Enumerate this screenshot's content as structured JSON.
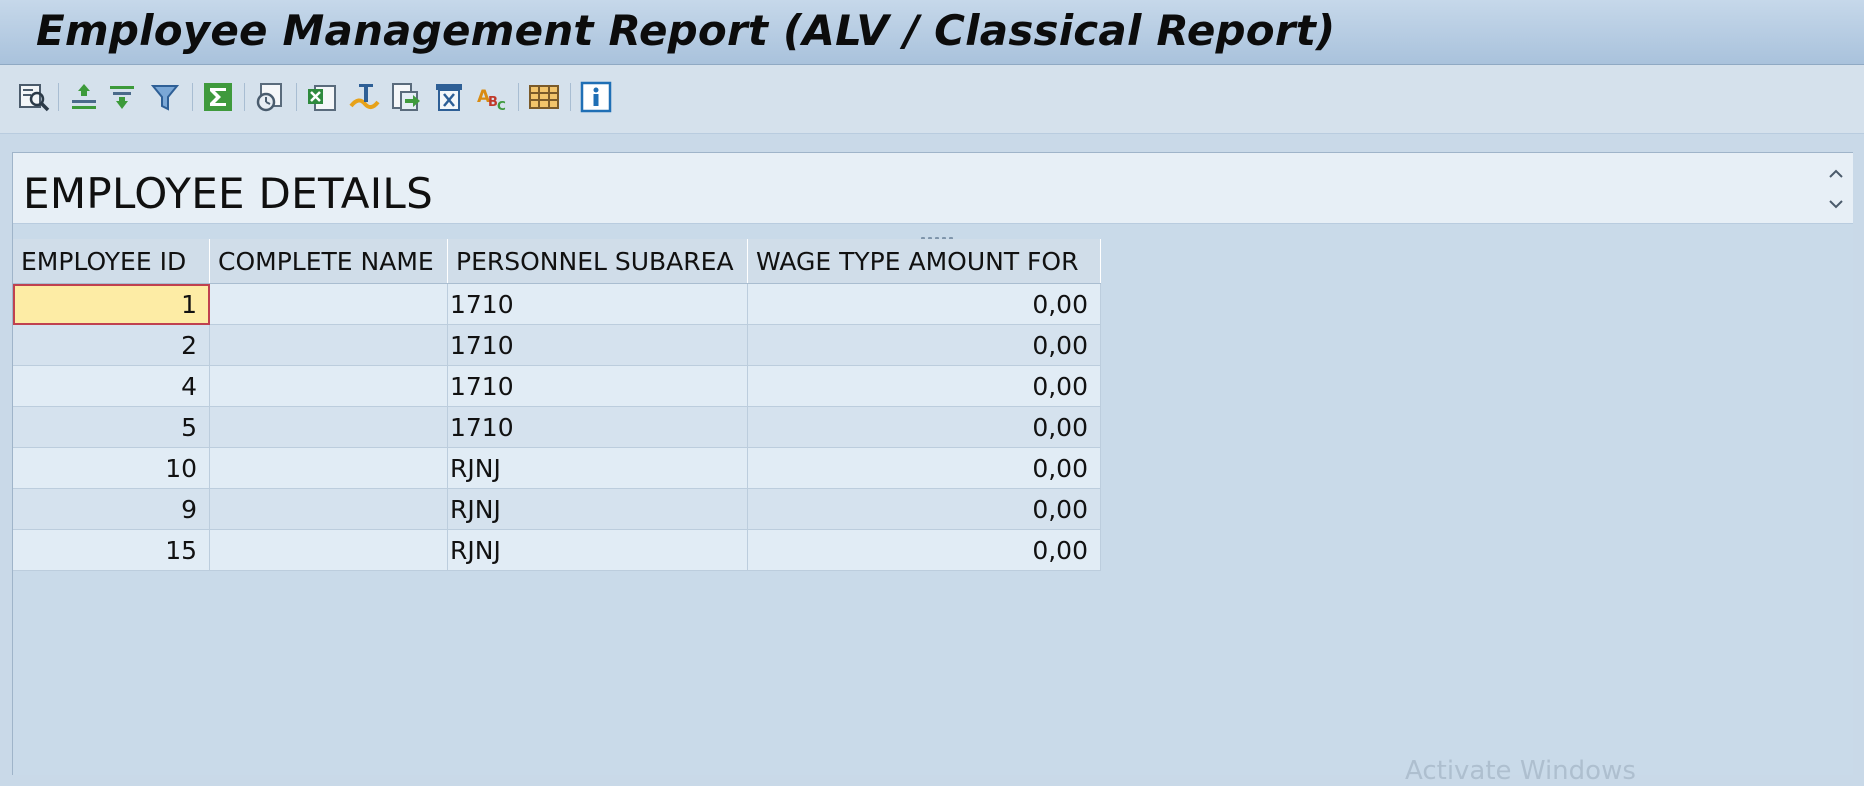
{
  "window": {
    "title": "Employee Management Report (ALV / Classical Report)"
  },
  "toolbar": {
    "buttons": [
      {
        "icon": "details-icon",
        "label": "Details"
      },
      {
        "icon": "sort-ascending-icon",
        "label": "Sort in Ascending Order"
      },
      {
        "icon": "sort-descending-icon",
        "label": "Sort in Descending Order"
      },
      {
        "icon": "filter-icon",
        "label": "Set Filter"
      },
      {
        "icon": "total-icon",
        "label": "Total"
      },
      {
        "icon": "print-preview-icon",
        "label": "Print Preview"
      },
      {
        "icon": "spreadsheet-icon",
        "label": "Spreadsheet"
      },
      {
        "icon": "word-processing-icon",
        "label": "Word Processing"
      },
      {
        "icon": "local-file-icon",
        "label": "Local File"
      },
      {
        "icon": "send-icon",
        "label": "Send"
      },
      {
        "icon": "abc-analysis-icon",
        "label": "ABC Analysis"
      },
      {
        "icon": "layout-icon",
        "label": "Change Layout"
      },
      {
        "icon": "info-icon",
        "label": "Information"
      }
    ]
  },
  "header": {
    "text": "EMPLOYEE DETAILS"
  },
  "table": {
    "columns": [
      "EMPLOYEE ID",
      "COMPLETE NAME",
      "PERSONNEL SUBAREA",
      "WAGE TYPE AMOUNT FOR"
    ],
    "rows": [
      [
        "1",
        "",
        "1710",
        "0,00"
      ],
      [
        "2",
        "",
        "1710",
        "0,00"
      ],
      [
        "4",
        "",
        "1710",
        "0,00"
      ],
      [
        "5",
        "",
        "1710",
        "0,00"
      ],
      [
        "10",
        "",
        "RJNJ",
        "0,00"
      ],
      [
        "9",
        "",
        "RJNJ",
        "0,00"
      ],
      [
        "15",
        "",
        "RJNJ",
        "0,00"
      ]
    ],
    "selected_cell": {
      "row": 0,
      "column": 0
    }
  },
  "watermark": {
    "text": "Activate Windows"
  },
  "colors": {
    "title_gradient": [
      "#c6d8ea",
      "#a9c2dc"
    ],
    "selected_cell": "#fdeca5",
    "selected_outline": "#c0414f",
    "row_odd": "#e1ecf5",
    "row_even": "#d5e2ee"
  }
}
